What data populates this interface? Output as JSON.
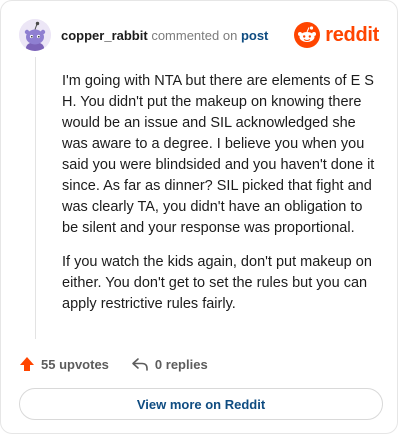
{
  "header": {
    "username": "copper_rabbit",
    "action_text": "commented on",
    "post_link": "post",
    "brand": "reddit"
  },
  "comment": {
    "paragraphs": [
      "I'm going with NTA but there are elements of E S H. You didn't put the makeup on knowing there would be an issue and SIL acknowledged she was aware to a degree. I believe you when you said you were blindsided and you haven't done it since. As far as dinner? SIL picked that fight and was clearly TA, you didn't have an obligation to be silent and your response was proportional.",
      "If you watch the kids again, don't put makeup on either. You don't get to set the rules but you can apply restrictive rules fairly."
    ]
  },
  "actions": {
    "upvotes": "55 upvotes",
    "replies": "0 replies"
  },
  "footer": {
    "view_more": "View more on Reddit"
  },
  "colors": {
    "accent": "#ff4500",
    "link": "#0f4c81",
    "text": "#1c1c1c",
    "muted": "#7c7c7c"
  },
  "icons": {
    "avatar": "snoo-avatar",
    "logo": "reddit-snoo-icon",
    "upvote": "upvote-arrow-icon",
    "reply": "reply-arrow-icon"
  }
}
